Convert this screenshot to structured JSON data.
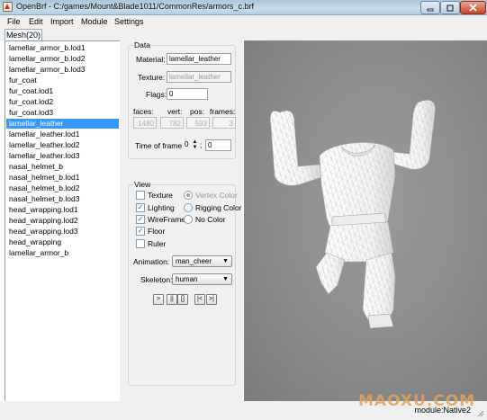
{
  "window": {
    "title": "OpenBrf - C:/games/Mount&Blade1011/CommonRes/armors_c.brf"
  },
  "menu": [
    "File",
    "Edit",
    "Import",
    "Module",
    "Settings"
  ],
  "tabs": [
    {
      "label": "Mesh(20)"
    }
  ],
  "mesh_list": {
    "items": [
      "lamellar_armor_b.lod1",
      "lamellar_armor_b.lod2",
      "lamellar_armor_b.lod3",
      "fur_coat",
      "fur_coat.lod1",
      "fur_coat.lod2",
      "fur_coat.lod3",
      "lamellar_leather",
      "lamellar_leather.lod1",
      "lamellar_leather.lod2",
      "lamellar_leather.lod3",
      "nasal_helmet_b",
      "nasal_helmet_b.lod1",
      "nasal_helmet_b.lod2",
      "nasal_helmet_b.lod3",
      "head_wrapping.lod1",
      "head_wrapping.lod2",
      "head_wrapping.lod3",
      "head_wrapping",
      "lamellar_armor_b"
    ],
    "selected_index": 7
  },
  "data_group": {
    "title": "Data",
    "material_label": "Material:",
    "material_value": "lamellar_leather",
    "texture_label": "Texture:",
    "texture_value": "lamellar_leather",
    "flags_label": "Flags:",
    "flags_value": "0",
    "faces_label": "faces:",
    "vert_label": "vert:",
    "pos_label": "pos:",
    "frames_label": "frames:",
    "faces_value": "1480",
    "vert_value": "782",
    "pos_value": "593",
    "frames_value": "3",
    "time_of_frame_label": "Time of frame",
    "time_frame_value": "0",
    "time_value": "0"
  },
  "view_group": {
    "title": "View",
    "texture_label": "Texture",
    "lighting_label": "Lighting",
    "wireframe_label": "WireFrame",
    "floor_label": "Floor",
    "ruler_label": "Ruler",
    "texture_checked": false,
    "lighting_checked": true,
    "wireframe_checked": true,
    "floor_checked": true,
    "ruler_checked": false,
    "vertex_color_label": "Vertex Color",
    "rigging_color_label": "Rigging Color",
    "no_color_label": "No Color",
    "animation_label": "Animation:",
    "animation_value": "man_cheer",
    "skeleton_label": "Skeleton:",
    "skeleton_value": "human",
    "player_buttons": [
      ">",
      "||",
      "[]",
      "|<",
      ">|"
    ]
  },
  "statusbar": {
    "module": "module:Native2"
  },
  "watermark": "MAOXU.COM",
  "colors": {
    "selection": "#3399ff",
    "viewport_bg": "#8d8d8d",
    "mesh": "#f6f6f6"
  }
}
